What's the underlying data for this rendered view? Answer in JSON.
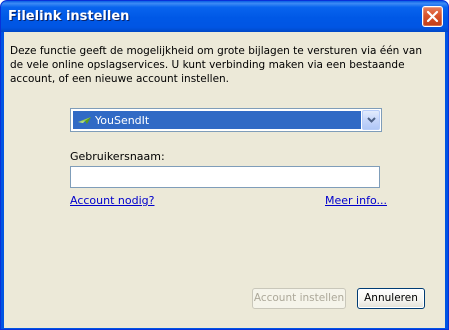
{
  "window": {
    "title": "Filelink instellen"
  },
  "dialog": {
    "description": "Deze functie geeft de mogelijkheid om grote bijlagen te versturen via één van de vele online opslagservices. U kunt verbinding maken via een bestaande account, of een nieuwe account instellen.",
    "provider_select": {
      "selected": "YouSendIt",
      "icon": "yousendit-logo-icon"
    },
    "username": {
      "label": "Gebruikersnaam:",
      "value": "",
      "placeholder": ""
    },
    "links": {
      "account_needed": "Account nodig?",
      "more_info": "Meer info..."
    },
    "buttons": {
      "setup_account": "Account instellen",
      "cancel": "Annuleren"
    }
  },
  "colors": {
    "title_bar": "#0054e3",
    "dialog_background": "#ece9d8",
    "selection": "#316ac5",
    "link": "#0000cc",
    "close_button": "#d9532b"
  }
}
